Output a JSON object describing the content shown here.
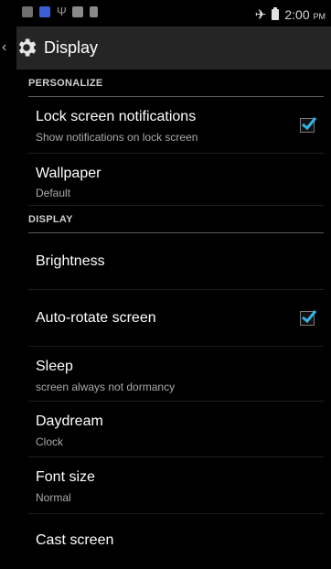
{
  "statusbar": {
    "time": "2:00",
    "ampm": "PM",
    "icons": [
      "notification-icon",
      "sim-icon",
      "usb-icon",
      "gallery-icon",
      "gallery-icon",
      "airplane-icon",
      "battery-icon"
    ]
  },
  "actionbar": {
    "title": "Display"
  },
  "accent": "#33b5e5",
  "sections": {
    "personalize": "PERSONALIZE",
    "display": "DISPLAY"
  },
  "prefs": {
    "lock_screen": {
      "title": "Lock screen notifications",
      "summary": "Show notifications on lock screen",
      "checked": true
    },
    "wallpaper": {
      "title": "Wallpaper",
      "summary": "Default"
    },
    "brightness": {
      "title": "Brightness"
    },
    "auto_rotate": {
      "title": "Auto-rotate screen",
      "checked": true
    },
    "sleep": {
      "title": "Sleep",
      "summary": "screen always not dormancy"
    },
    "daydream": {
      "title": "Daydream",
      "summary": "Clock"
    },
    "font_size": {
      "title": "Font size",
      "summary": "Normal"
    },
    "cast": {
      "title": "Cast screen"
    }
  }
}
